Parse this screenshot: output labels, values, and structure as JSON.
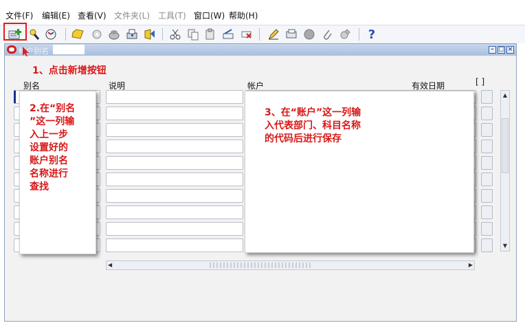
{
  "menu": [
    {
      "label": "文件(F)",
      "enabled": true
    },
    {
      "label": "编辑(E)",
      "enabled": true
    },
    {
      "label": "查看(V)",
      "enabled": true
    },
    {
      "label": "文件夹(L)",
      "enabled": false
    },
    {
      "label": "工具(T)",
      "enabled": false
    },
    {
      "label": "窗口(W)",
      "enabled": true
    },
    {
      "label": "帮助(H)",
      "enabled": true
    }
  ],
  "toolbar": {
    "icons": [
      "new-record-icon",
      "find-icon",
      "navigate-icon",
      "folder-icon",
      "zoom-icon",
      "save-icon",
      "print-icon",
      "close-form-icon",
      "cut-icon",
      "copy-icon",
      "paste-icon",
      "clear-record-icon",
      "delete-record-icon",
      "edit-field-icon",
      "translations-icon",
      "attachments-icon",
      "folder-tools-icon",
      "help-icon"
    ],
    "help_label": "?"
  },
  "window": {
    "title_faded": "帐户别名",
    "columns": {
      "alias": "别名",
      "description": "说明",
      "account": "帐户",
      "effective_date": "有效日期"
    },
    "brackets": "[ ]",
    "row_count": 10
  },
  "annotations": {
    "step1": "1、点击新增按钮",
    "step2": "2.在“别名\n”这一列输\n入上一步\n设置好的\n账户别名\n名称进行\n查找",
    "step3": "3、在“账户”这一列输\n入代表部门、科目名称\n的代码后进行保存"
  },
  "colors": {
    "annotation": "#d81818",
    "titlebar": "#b3c7e4",
    "highlight": "#e21a1a"
  }
}
